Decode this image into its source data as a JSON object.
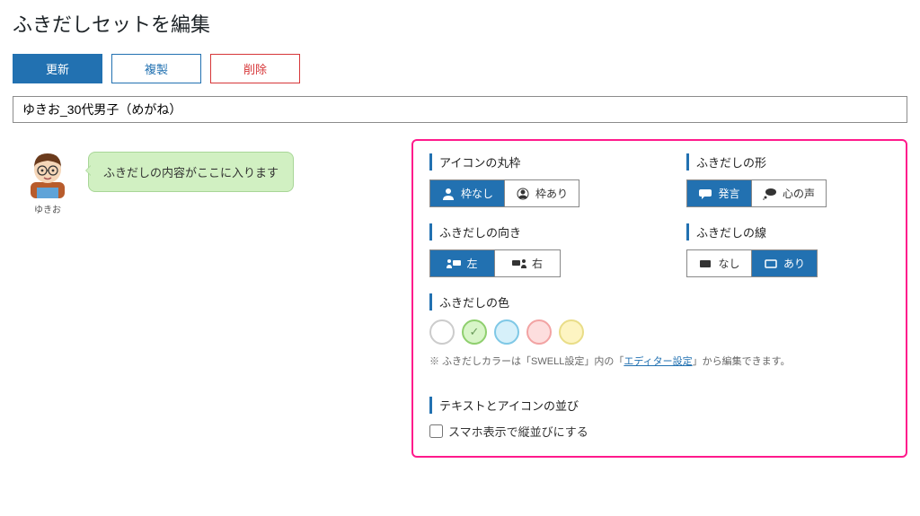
{
  "page": {
    "title": "ふきだしセットを編集"
  },
  "actions": {
    "update": "更新",
    "duplicate": "複製",
    "delete": "削除"
  },
  "name_input": {
    "value": "ゆきお_30代男子（めがね）"
  },
  "preview": {
    "avatar_label": "ゆきお",
    "bubble_text": "ふきだしの内容がここに入ります"
  },
  "fields": {
    "icon_frame": {
      "label": "アイコンの丸枠",
      "opt_no": "枠なし",
      "opt_yes": "枠あり",
      "selected": "no"
    },
    "shape": {
      "label": "ふきだしの形",
      "opt_speak": "発言",
      "opt_think": "心の声",
      "selected": "speak"
    },
    "direction": {
      "label": "ふきだしの向き",
      "opt_left": "左",
      "opt_right": "右",
      "selected": "left"
    },
    "border": {
      "label": "ふきだしの線",
      "opt_no": "なし",
      "opt_yes": "あり",
      "selected": "yes"
    },
    "color": {
      "label": "ふきだしの色",
      "hint_prefix": "※ ふきだしカラーは「SWELL設定」内の「",
      "hint_link": "エディター設定",
      "hint_suffix": "」から編集できます。",
      "swatches": [
        {
          "fill": "#ffffff",
          "border": "#cccccc"
        },
        {
          "fill": "#d8f5c8",
          "border": "#8fcf6e"
        },
        {
          "fill": "#d6f0fa",
          "border": "#7fc8e6"
        },
        {
          "fill": "#fddede",
          "border": "#f2a3a3"
        },
        {
          "fill": "#fdf4c2",
          "border": "#e9dd88"
        }
      ],
      "selected_index": 1
    },
    "align": {
      "label": "テキストとアイコンの並び",
      "checkbox": "スマホ表示で縦並びにする"
    }
  }
}
